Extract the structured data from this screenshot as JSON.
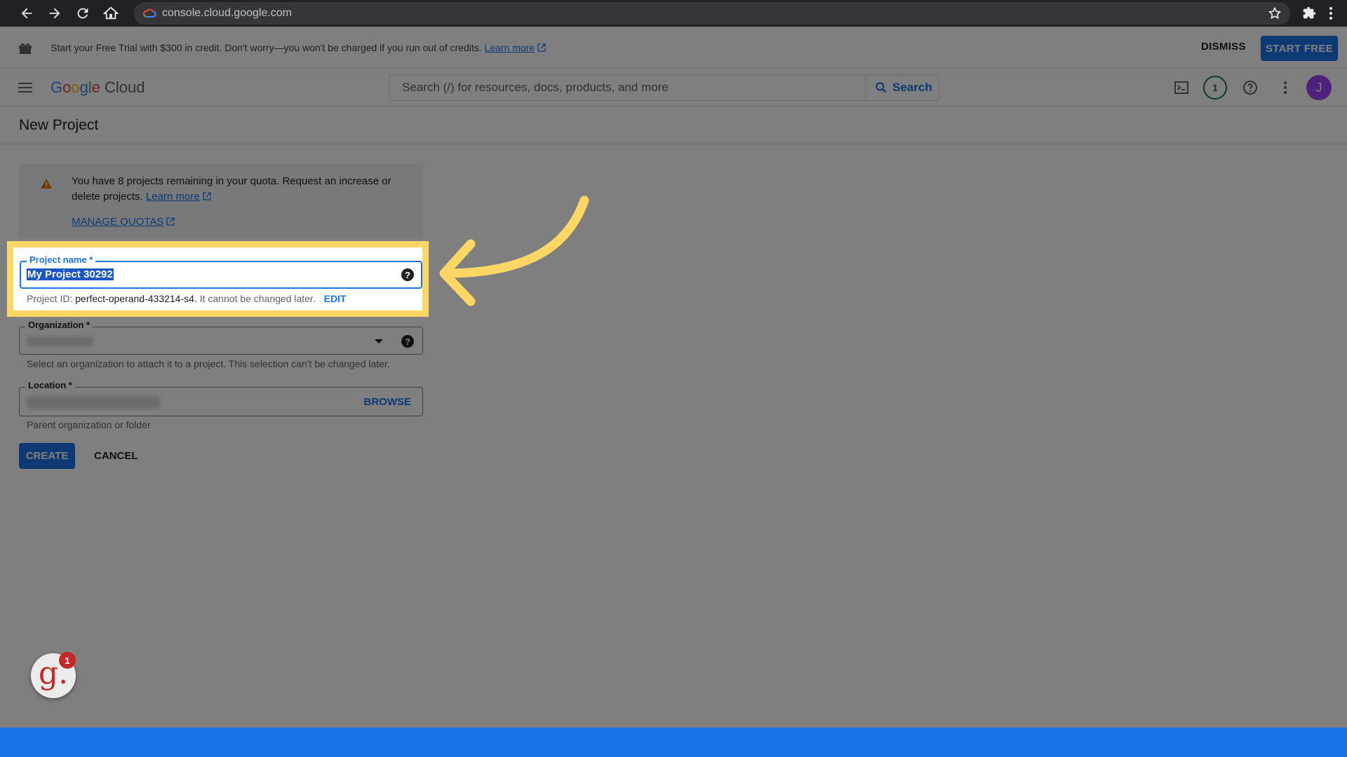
{
  "browser": {
    "url": "console.cloud.google.com"
  },
  "banner": {
    "text": "Start your Free Trial with $300 in credit. Don't worry—you won't be charged if you run out of credits.",
    "learn_more": "Learn more",
    "dismiss": "DISMISS",
    "start_free": "START FREE"
  },
  "header": {
    "logo_google": [
      "G",
      "o",
      "o",
      "g",
      "l",
      "e"
    ],
    "logo_cloud": "Cloud",
    "search_placeholder": "Search (/) for resources, docs, products, and more",
    "search_button": "Search",
    "notification_count": "1",
    "avatar_initial": "J"
  },
  "page": {
    "title": "New Project"
  },
  "quota": {
    "text": "You have 8 projects remaining in your quota. Request an increase or delete projects.",
    "learn_more": "Learn more",
    "manage_quotas": "MANAGE QUOTAS"
  },
  "form": {
    "project_name_label": "Project name *",
    "project_name_value": "My Project 30292",
    "project_id_prefix": "Project ID:",
    "project_id_value": "perfect-operand-433214-s4.",
    "project_id_suffix": "It cannot be changed later.",
    "edit": "EDIT",
    "organization_label": "Organization *",
    "organization_hint": "Select an organization to attach it to a project. This selection can't be changed later.",
    "location_label": "Location *",
    "browse": "BROWSE",
    "location_hint": "Parent organization or folder",
    "create": "CREATE",
    "cancel": "CANCEL"
  },
  "widget": {
    "letter": "g.",
    "badge": "1"
  },
  "colors": {
    "accent": "#1a73e8",
    "highlight": "#fdd663",
    "overlay": "rgba(0,0,0,0.5)"
  }
}
